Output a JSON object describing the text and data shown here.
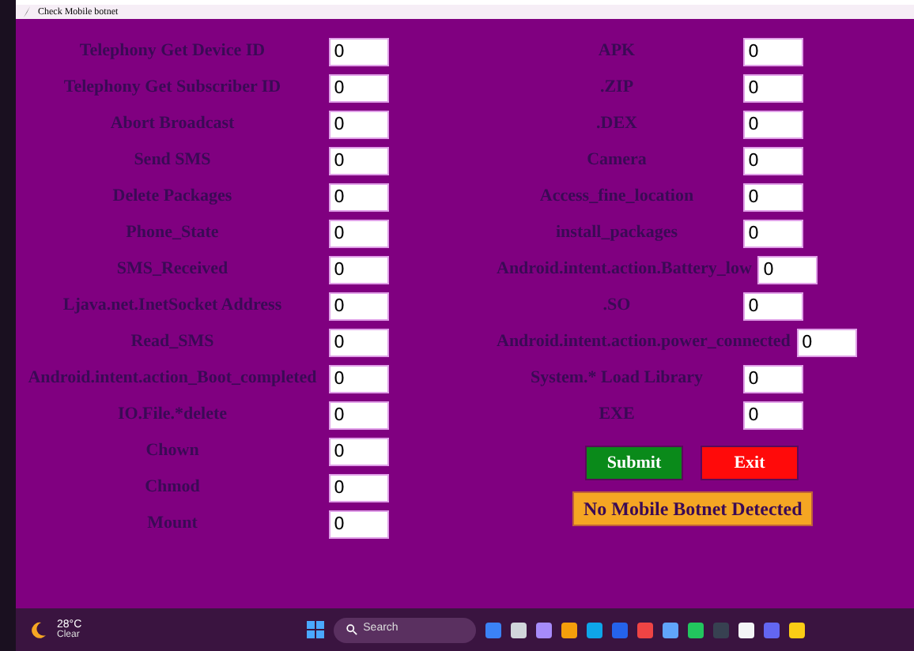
{
  "window": {
    "title": "Check Mobile botnet"
  },
  "left_fields": [
    {
      "label": "Telephony Get Device ID",
      "value": "0"
    },
    {
      "label": "Telephony Get Subscriber ID",
      "value": "0"
    },
    {
      "label": "Abort Broadcast",
      "value": "0"
    },
    {
      "label": "Send SMS",
      "value": "0"
    },
    {
      "label": "Delete Packages",
      "value": "0"
    },
    {
      "label": "Phone_State",
      "value": "0"
    },
    {
      "label": "SMS_Received",
      "value": "0"
    },
    {
      "label": "Ljava.net.InetSocket Address",
      "value": "0"
    },
    {
      "label": "Read_SMS",
      "value": "0"
    },
    {
      "label": "Android.intent.action_Boot_completed",
      "value": "0"
    },
    {
      "label": "IO.File.*delete",
      "value": "0"
    },
    {
      "label": "Chown",
      "value": "0"
    },
    {
      "label": "Chmod",
      "value": "0"
    },
    {
      "label": "Mount",
      "value": "0"
    }
  ],
  "right_fields": [
    {
      "label": "APK",
      "value": "0"
    },
    {
      "label": ".ZIP",
      "value": "0"
    },
    {
      "label": ".DEX",
      "value": "0"
    },
    {
      "label": "Camera",
      "value": "0"
    },
    {
      "label": "Access_fine_location",
      "value": "0"
    },
    {
      "label": "install_packages",
      "value": "0"
    },
    {
      "label": "Android.intent.action.Battery_low",
      "value": "0"
    },
    {
      "label": ".SO",
      "value": "0"
    },
    {
      "label": "Android.intent.action.power_connected",
      "value": "0"
    },
    {
      "label": "System.* Load Library",
      "value": "0"
    },
    {
      "label": "EXE",
      "value": "0"
    }
  ],
  "buttons": [
    {
      "label": "Submit",
      "kind": "submit"
    },
    {
      "label": "Exit",
      "kind": "exit"
    }
  ],
  "result": "No Mobile Botnet Detected",
  "taskbar": {
    "temperature": "28°C",
    "weather": "Clear",
    "search": {
      "placeholder": "Search"
    }
  }
}
